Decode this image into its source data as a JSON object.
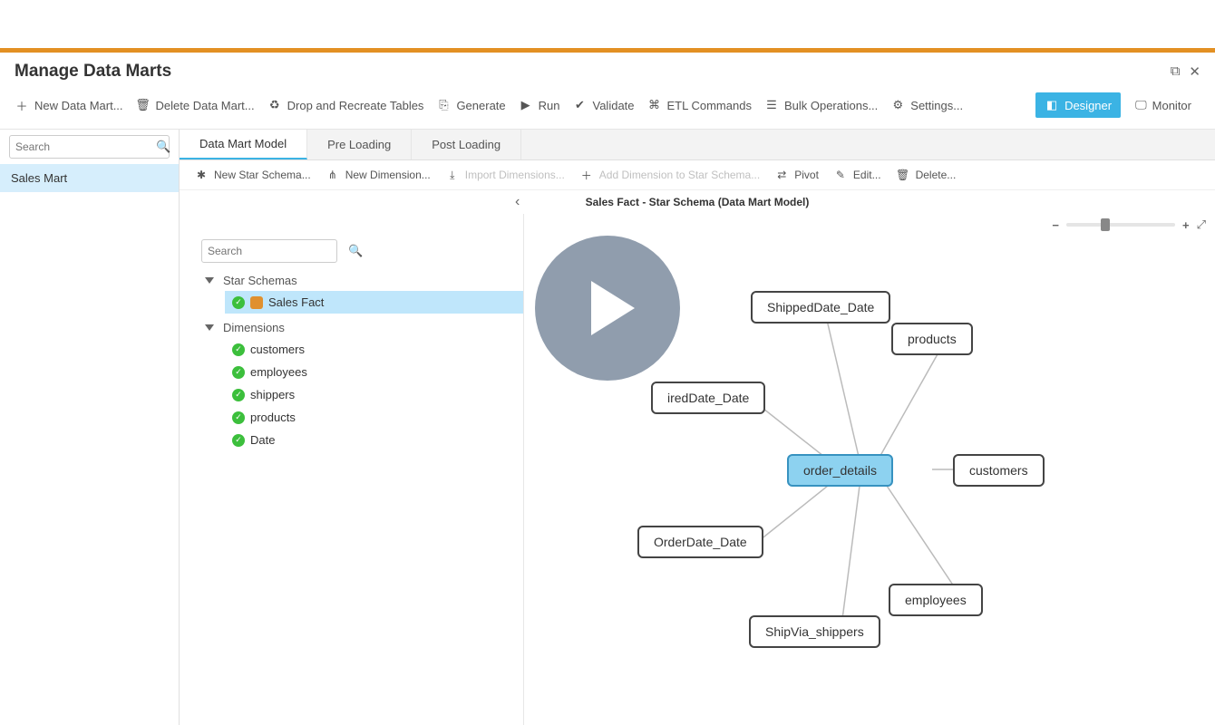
{
  "page_title": "Manage Data Marts",
  "toolbar": {
    "new": "New Data Mart...",
    "delete": "Delete Data Mart...",
    "drop": "Drop and Recreate Tables",
    "generate": "Generate",
    "run": "Run",
    "validate": "Validate",
    "etl": "ETL Commands",
    "bulk": "Bulk Operations...",
    "settings": "Settings..."
  },
  "modes": {
    "designer": "Designer",
    "monitor": "Monitor"
  },
  "left": {
    "search_placeholder": "Search",
    "data_mart": "Sales Mart"
  },
  "tabs": {
    "model": "Data Mart Model",
    "pre": "Pre Loading",
    "post": "Post Loading"
  },
  "subtoolbar": {
    "new_star": "New Star Schema...",
    "new_dim": "New Dimension...",
    "import_dims": "Import Dimensions...",
    "add_dim": "Add Dimension to Star Schema...",
    "pivot": "Pivot",
    "edit": "Edit...",
    "delete": "Delete..."
  },
  "tree": {
    "search_placeholder": "Search",
    "star_header": "Star Schemas",
    "fact": "Sales Fact",
    "dim_header": "Dimensions",
    "dims": [
      "customers",
      "employees",
      "shippers",
      "products",
      "Date"
    ]
  },
  "breadcrumb": {
    "back": "‹",
    "text": "Sales Fact - Star Schema (Data Mart Model)"
  },
  "nodes": {
    "center": "order_details",
    "shipped": "ShippedDate_Date",
    "products": "products",
    "required": "iredDate_Date",
    "customers": "customers",
    "orderdate": "OrderDate_Date",
    "employees": "employees",
    "shipvia": "ShipVia_shippers"
  }
}
